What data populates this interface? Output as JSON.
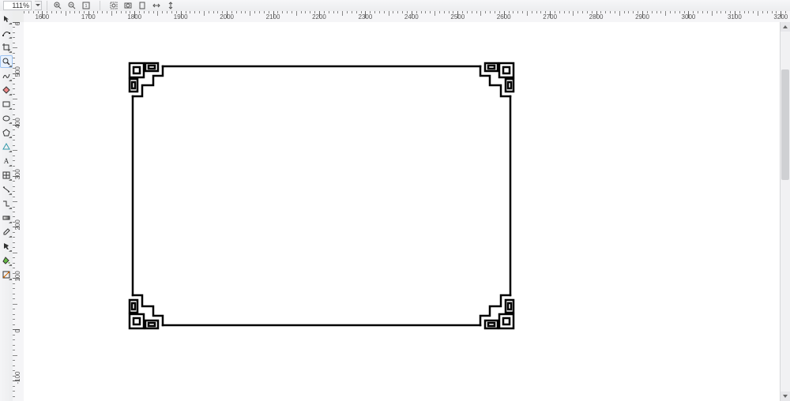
{
  "toolbar": {
    "zoom_value": "111%",
    "icons": [
      "zoom-in-icon",
      "zoom-out-icon",
      "zoom-actual-icon",
      "zoom-selection-icon",
      "zoom-fit-icon",
      "zoom-page-icon",
      "zoom-width-icon",
      "zoom-height-icon"
    ]
  },
  "ruler_h": {
    "start": 1560,
    "end": 3220,
    "step": 100,
    "minor": 10
  },
  "ruler_v": {
    "start": 600,
    "end": -140,
    "step": 100,
    "minor": 10
  },
  "toolbox": {
    "tools": [
      {
        "name": "pick-tool-icon",
        "selected": false
      },
      {
        "name": "shape-tool-icon",
        "selected": false
      },
      {
        "name": "crop-tool-icon",
        "selected": false
      },
      {
        "name": "zoom-tool-icon",
        "selected": true
      },
      {
        "name": "freehand-tool-icon",
        "selected": false
      },
      {
        "name": "smart-fill-tool-icon",
        "selected": false
      },
      {
        "name": "rectangle-tool-icon",
        "selected": false
      },
      {
        "name": "ellipse-tool-icon",
        "selected": false
      },
      {
        "name": "polygon-tool-icon",
        "selected": false
      },
      {
        "name": "basic-shapes-tool-icon",
        "selected": false
      },
      {
        "name": "text-tool-icon",
        "selected": false
      },
      {
        "name": "table-tool-icon",
        "selected": false
      },
      {
        "name": "dimension-tool-icon",
        "selected": false
      },
      {
        "name": "connector-tool-icon",
        "selected": false
      },
      {
        "name": "interactive-effects-tool-icon",
        "selected": false
      },
      {
        "name": "eyedropper-tool-icon",
        "selected": false
      },
      {
        "name": "outline-tool-icon",
        "selected": false
      },
      {
        "name": "fill-tool-icon",
        "selected": false
      },
      {
        "name": "interactive-fill-tool-icon",
        "selected": false
      }
    ]
  },
  "artwork": {
    "description": "decorative-greek-key-rectangle-frame"
  }
}
